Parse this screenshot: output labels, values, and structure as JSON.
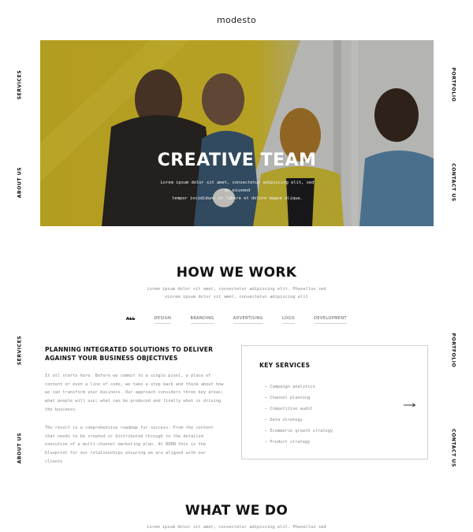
{
  "brand": {
    "logo": "modesto"
  },
  "side_nav": {
    "services": "SERVICES",
    "about": "ABOUT US",
    "portfolio": "PORTFOLIO",
    "contact": "CONTACT US"
  },
  "hero": {
    "title": "CREATIVE TEAM",
    "subtitle_line1": "Lorem ipsum dolor sit amet, consectetur adipiscing elit, sed do eiusmod",
    "subtitle_line2": "tempor incididunt ut labore et dolore magna aliqua."
  },
  "how_we_work": {
    "title": "HOW WE WORK",
    "subtitle_line1": "Lorem ipsum dolor sit amet, consectetur adipiscing elit. Phasellus sed",
    "subtitle_line2": "xLorem ipsum dolor sit amet, consectetur adipiscing elit",
    "filters": [
      "ALL",
      "DESIGN",
      "BRANDING",
      "ADVERTISING",
      "LOGO",
      "DEVELOPMENT"
    ],
    "active_filter": "ALL"
  },
  "planning": {
    "heading": "PLANNING INTEGRATED SOLUTIONS TO DELIVER AGAINST YOUR BUSINESS OBJECTIVES",
    "para1_lines": [
      "It all starts here. Before we commit to a single pixel, a place of",
      "content or even a line of code, we take a step back and think about how",
      "we can transform your business. Our approach considers three key areas;",
      "what people will use; what can be produced and finally what is driving",
      "the business."
    ],
    "para2_lines": [
      "The result is a comprehensive roadmap for success. From the content",
      "that needs to be created or distributed through to the detailed",
      "execution of a multi-channel marketing plan. At BORN this is the",
      "blueprint for our relationships ensuring we are aligned with our",
      "clients"
    ]
  },
  "key_services": {
    "title": "KEY SERVICES",
    "items": [
      "— Campaign analytics",
      "— Channel planning",
      "— Competitive audit",
      "— Data strategy",
      "— Ecommerce growth strategy",
      "— Product strategy"
    ],
    "arrow_icon": "arrow-right-icon"
  },
  "what_we_do": {
    "title": "WHAT WE DO",
    "subtitle_line1": "Lorem ipsum dolor sit amet, consectetur adipiscing elit. Phasellus sed"
  },
  "colors": {
    "accent_yellow": "#f2d21c",
    "text_dark": "#111111",
    "text_muted": "#888888"
  }
}
